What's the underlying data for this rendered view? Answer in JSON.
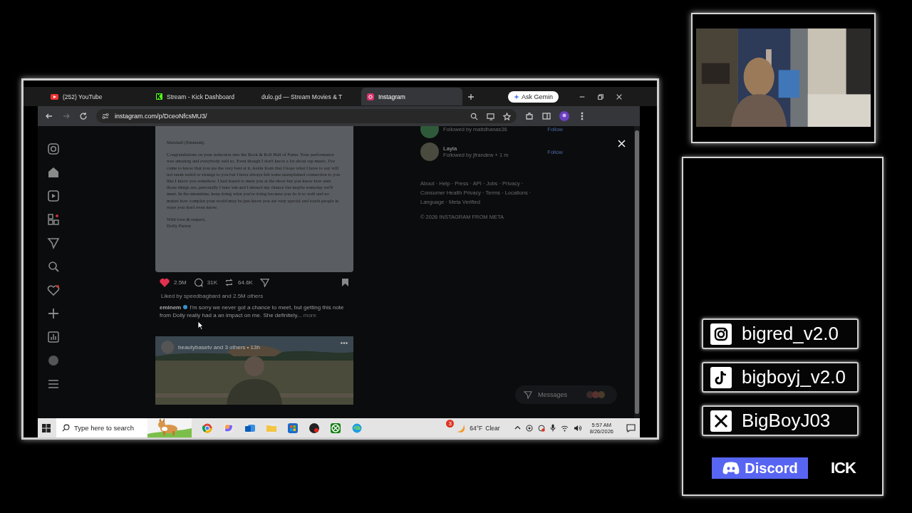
{
  "browser": {
    "tabs": [
      {
        "label": "(252) YouTube",
        "kind": "youtube",
        "selected": false
      },
      {
        "label": "Stream - Kick Dashboard",
        "kind": "kick",
        "selected": false
      },
      {
        "label": "dulo.gd — Stream Movies & T",
        "kind": "plain",
        "selected": false
      },
      {
        "label": "Instagram",
        "kind": "instagram",
        "selected": true
      }
    ],
    "ask_button": "Ask Gemin",
    "address": "instagram.com/p/DceoNfcsMU3/"
  },
  "post": {
    "letter": {
      "salutation": "Marshall (Eminem),",
      "body": "Congratulations on your induction into the Rock & Roll Hall of Fame. Your performance was amazing and everybody said so. Even though I don't know a lot about rap music, I've come to know that you are the very best at it. Aside from that I hope what I have to say will not seem weird or strange to you but I have always felt some unexplained connection to you like I know you somehow. I had hoped to meet you at the show but you know how unis those things are, personally I hate 'em and I missed my chance but maybe someday we'll meet. In the meantime, keep doing what you're doing because you do it so well and no matter how complex your world may be just know you are very special and touch people in ways you don't even know.",
      "closing": "With love & respect,",
      "signature": "Dolly Parton"
    },
    "liked": true,
    "likes": "2.5M",
    "comments": "31K",
    "reposts": "64.6K",
    "liked_by": "Liked by speedbagbard and 2.5M others",
    "caption_user": "eminem",
    "verified": true,
    "caption": "I'm sorry we never got a chance to meet, but getting this note from Dolly really had a an impact on me. She definitely...",
    "more": "more"
  },
  "next_post": {
    "header": "beautybasetv and 3 others • 13h"
  },
  "suggestions": [
    {
      "detail": "Followed by mattdhanas36",
      "follow": "Follow"
    },
    {
      "name": "Layla",
      "detail": "Followed by jfrandew + 1 m",
      "follow": "Follow"
    }
  ],
  "footer_links": [
    "About · Help · Press · API · Jobs · Privacy ·",
    "Consumer Health Privacy · Terms · Locations ·",
    "Language · Meta Verified"
  ],
  "copyright": "© 2026 INSTAGRAM FROM META",
  "messages": "Messages",
  "taskbar": {
    "search_placeholder": "Type here to search",
    "weather_badge": "3",
    "temperature": "64°F",
    "condition": "Clear",
    "time": "5:57 AM",
    "date": "8/26/2026"
  },
  "socials": [
    {
      "kind": "instagram",
      "handle": "bigred_v2.0"
    },
    {
      "kind": "tiktok",
      "handle": "bigboyj_v2.0"
    },
    {
      "kind": "x",
      "handle": "BigBoyJ03"
    }
  ],
  "discord": "Discord",
  "kick": "ICK"
}
